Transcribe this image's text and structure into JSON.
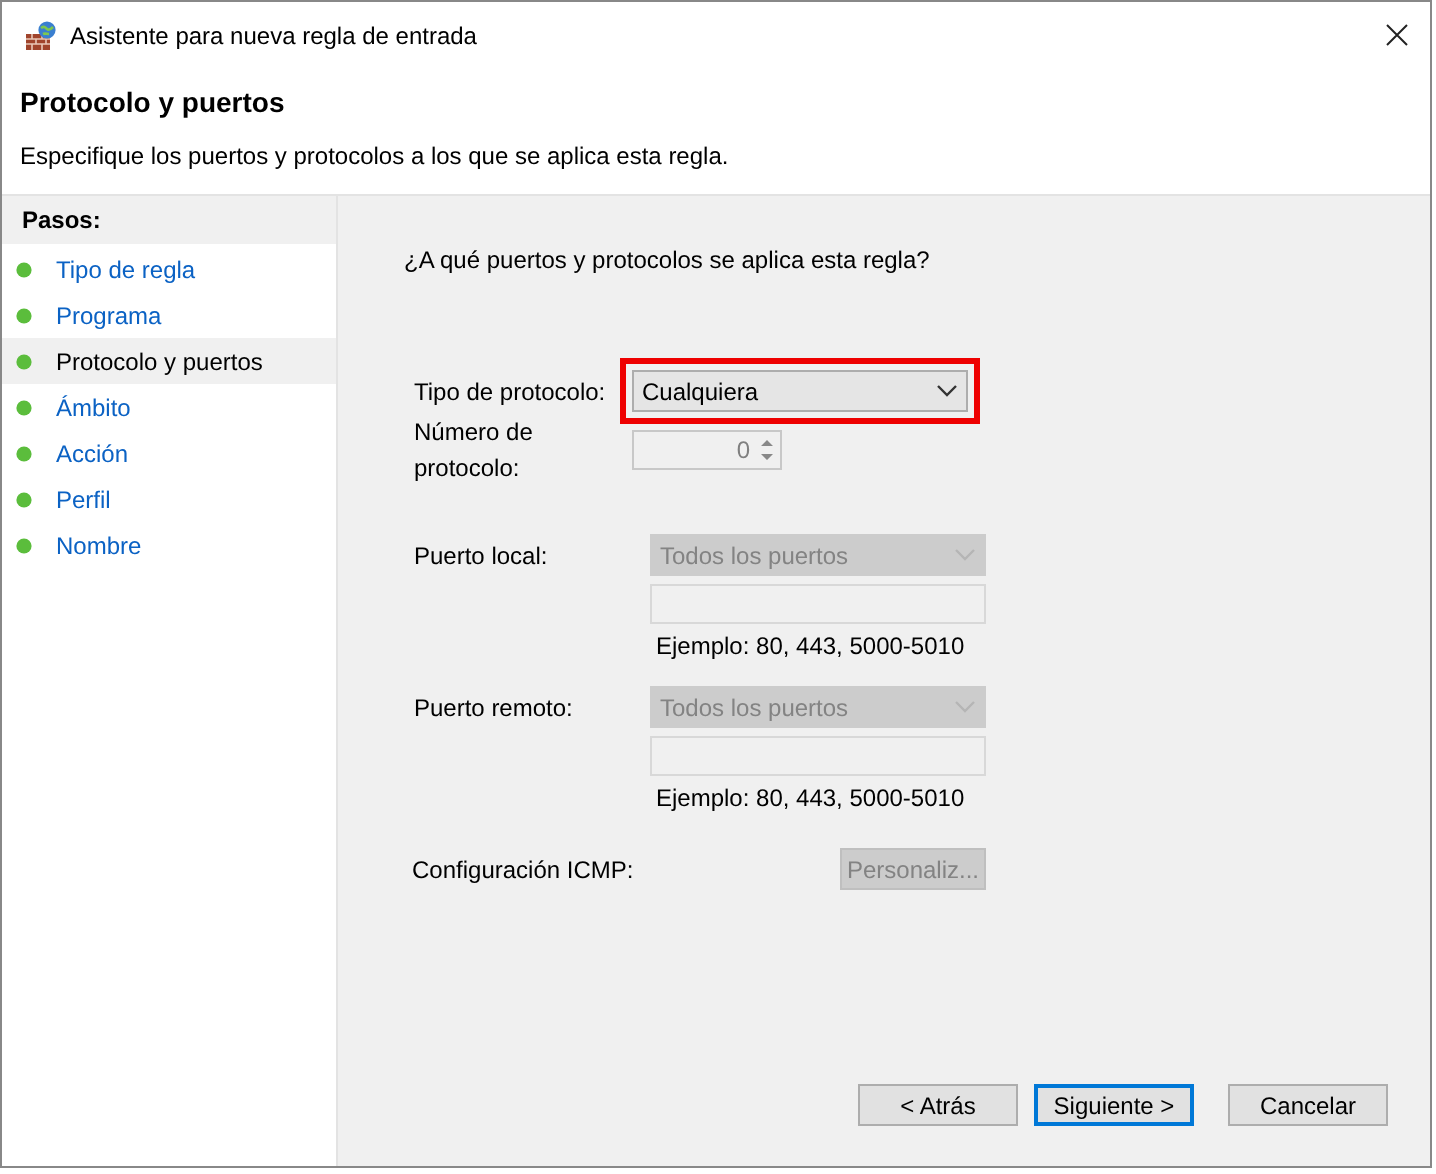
{
  "window": {
    "title": "Asistente para nueva regla de entrada"
  },
  "header": {
    "title": "Protocolo y puertos",
    "subtitle": "Especifique los puertos y protocolos a los que se aplica esta regla."
  },
  "sidebar": {
    "heading": "Pasos:",
    "items": [
      {
        "label": "Tipo de regla",
        "selected": false
      },
      {
        "label": "Programa",
        "selected": false
      },
      {
        "label": "Protocolo y puertos",
        "selected": true
      },
      {
        "label": "Ámbito",
        "selected": false
      },
      {
        "label": "Acción",
        "selected": false
      },
      {
        "label": "Perfil",
        "selected": false
      },
      {
        "label": "Nombre",
        "selected": false
      }
    ]
  },
  "question": "¿A qué puertos y protocolos se aplica esta regla?",
  "protocol_type": {
    "label": "Tipo de protocolo:",
    "value": "Cualquiera",
    "highlighted": true,
    "disabled": false
  },
  "protocol_number": {
    "label": "Número de protocolo:",
    "value": "0",
    "disabled": true
  },
  "ports": [
    {
      "label": "Puerto local:",
      "value": "Todos los puertos",
      "disabled": true,
      "example": "Ejemplo: 80, 443, 5000-5010"
    },
    {
      "label": "Puerto remoto:",
      "value": "Todos los puertos",
      "disabled": true,
      "example": "Ejemplo: 80, 443, 5000-5010"
    }
  ],
  "icmp": {
    "label": "Configuración ICMP:",
    "button": "Personaliz...",
    "disabled": true
  },
  "buttons": [
    {
      "label": "< Atrás",
      "selected": false
    },
    {
      "label": "Siguiente >",
      "selected": true
    },
    {
      "label": "Cancelar",
      "selected": false
    }
  ]
}
